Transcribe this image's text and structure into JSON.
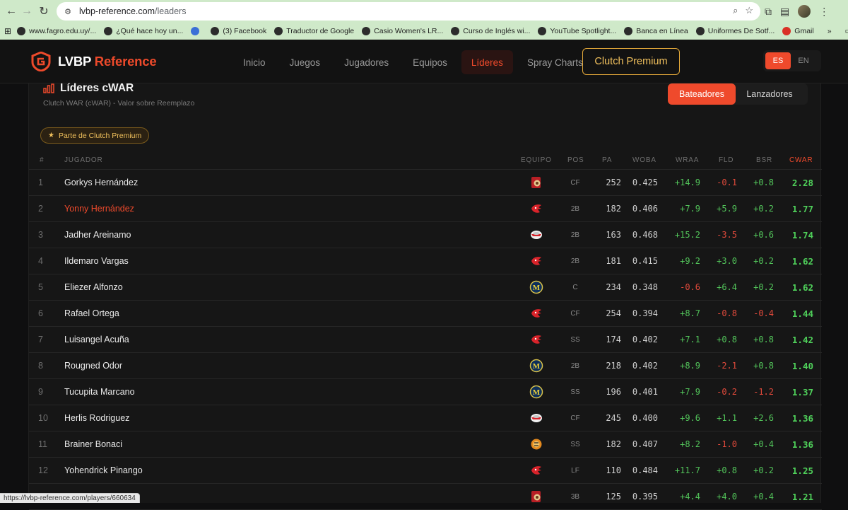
{
  "browser": {
    "url_host": "lvbp-reference.com",
    "url_path": "/leaders",
    "status_url": "https://lvbp-reference.com/players/660634",
    "bookmarks": [
      {
        "label": "www.fagro.edu.uy/...",
        "color": "#2c2c2c"
      },
      {
        "label": "¿Qué hace hoy un...",
        "color": "#2c2c2c"
      },
      {
        "label": "",
        "color": "#3b6fd6"
      },
      {
        "label": "(3) Facebook",
        "color": "#2c2c2c"
      },
      {
        "label": "Traductor de Google",
        "color": "#2c2c2c"
      },
      {
        "label": "Casio Women's LR...",
        "color": "#2c2c2c"
      },
      {
        "label": "Curso de Inglés wi...",
        "color": "#2c2c2c"
      },
      {
        "label": "YouTube Spotlight...",
        "color": "#2c2c2c"
      },
      {
        "label": "Banca en Línea",
        "color": "#2c2c2c"
      },
      {
        "label": "Uniformes De Sotf...",
        "color": "#2c2c2c"
      },
      {
        "label": "Gmail",
        "color": "#d93025"
      }
    ],
    "more_label": "»",
    "all_bookmarks": "All Bookmarks"
  },
  "site": {
    "brand": "LVBP",
    "brand_accent": "Reference",
    "nav": [
      {
        "label": "Inicio",
        "active": false
      },
      {
        "label": "Juegos",
        "active": false
      },
      {
        "label": "Jugadores",
        "active": false
      },
      {
        "label": "Equipos",
        "active": false
      },
      {
        "label": "Líderes",
        "active": true
      },
      {
        "label": "Spray Charts",
        "active": false
      }
    ],
    "premium": "Clutch Premium",
    "lang": [
      "ES",
      "EN"
    ]
  },
  "page": {
    "title": "Líderes cWAR",
    "subtitle": "Clutch WAR (cWAR) - Valor sobre Reemplazo",
    "toggle": [
      "Bateadores",
      "Lanzadores"
    ],
    "badge": "Parte de Clutch Premium"
  },
  "table": {
    "headers": [
      "#",
      "JUGADOR",
      "EQUIPO",
      "POS",
      "PA",
      "WOBA",
      "WRAA",
      "FLD",
      "BSR",
      "CWAR"
    ],
    "rows": [
      {
        "n": "1",
        "name": "Gorkys Hernández",
        "team": "leones",
        "pos": "CF",
        "pa": "252",
        "woba": "0.425",
        "wraa": "+14.9",
        "fld": "-0.1",
        "bsr": "+0.8",
        "cwar": "2.28",
        "hl": false
      },
      {
        "n": "2",
        "name": "Yonny Hernández",
        "team": "cardenales",
        "pos": "2B",
        "pa": "182",
        "woba": "0.406",
        "wraa": "+7.9",
        "fld": "+5.9",
        "bsr": "+0.2",
        "cwar": "1.77",
        "hl": true
      },
      {
        "n": "3",
        "name": "Jadher Areinamo",
        "team": "tiburones",
        "pos": "2B",
        "pa": "163",
        "woba": "0.468",
        "wraa": "+15.2",
        "fld": "-3.5",
        "bsr": "+0.6",
        "cwar": "1.74",
        "hl": false
      },
      {
        "n": "4",
        "name": "Ildemaro Vargas",
        "team": "cardenales",
        "pos": "2B",
        "pa": "181",
        "woba": "0.415",
        "wraa": "+9.2",
        "fld": "+3.0",
        "bsr": "+0.2",
        "cwar": "1.62",
        "hl": false
      },
      {
        "n": "5",
        "name": "Eliezer Alfonzo",
        "team": "magallanes",
        "pos": "C",
        "pa": "234",
        "woba": "0.348",
        "wraa": "-0.6",
        "fld": "+6.4",
        "bsr": "+0.2",
        "cwar": "1.62",
        "hl": false
      },
      {
        "n": "6",
        "name": "Rafael Ortega",
        "team": "cardenales",
        "pos": "CF",
        "pa": "254",
        "woba": "0.394",
        "wraa": "+8.7",
        "fld": "-0.8",
        "bsr": "-0.4",
        "cwar": "1.44",
        "hl": false
      },
      {
        "n": "7",
        "name": "Luisangel Acuña",
        "team": "cardenales",
        "pos": "SS",
        "pa": "174",
        "woba": "0.402",
        "wraa": "+7.1",
        "fld": "+0.8",
        "bsr": "+0.8",
        "cwar": "1.42",
        "hl": false
      },
      {
        "n": "8",
        "name": "Rougned Odor",
        "team": "magallanes",
        "pos": "2B",
        "pa": "218",
        "woba": "0.402",
        "wraa": "+8.9",
        "fld": "-2.1",
        "bsr": "+0.8",
        "cwar": "1.40",
        "hl": false
      },
      {
        "n": "9",
        "name": "Tucupita Marcano",
        "team": "magallanes",
        "pos": "SS",
        "pa": "196",
        "woba": "0.401",
        "wraa": "+7.9",
        "fld": "-0.2",
        "bsr": "-1.2",
        "cwar": "1.37",
        "hl": false
      },
      {
        "n": "10",
        "name": "Herlis Rodriguez",
        "team": "tiburones",
        "pos": "CF",
        "pa": "245",
        "woba": "0.400",
        "wraa": "+9.6",
        "fld": "+1.1",
        "bsr": "+2.6",
        "cwar": "1.36",
        "hl": false
      },
      {
        "n": "11",
        "name": "Brainer Bonaci",
        "team": "tigres",
        "pos": "SS",
        "pa": "182",
        "woba": "0.407",
        "wraa": "+8.2",
        "fld": "-1.0",
        "bsr": "+0.4",
        "cwar": "1.36",
        "hl": false
      },
      {
        "n": "12",
        "name": "Yohendrick Pinango",
        "team": "cardenales",
        "pos": "LF",
        "pa": "110",
        "woba": "0.484",
        "wraa": "+11.7",
        "fld": "+0.8",
        "bsr": "+0.2",
        "cwar": "1.25",
        "hl": false
      },
      {
        "n": "13",
        "name": "",
        "team": "leones",
        "pos": "3B",
        "pa": "125",
        "woba": "0.395",
        "wraa": "+4.4",
        "fld": "+4.0",
        "bsr": "+0.4",
        "cwar": "1.21",
        "hl": false
      }
    ]
  },
  "colors": {
    "accent": "#ef4a2c",
    "premium": "#f3c25e",
    "positive": "#52c45a",
    "negative": "#e24a3b",
    "cwar": "#4fd05a"
  }
}
